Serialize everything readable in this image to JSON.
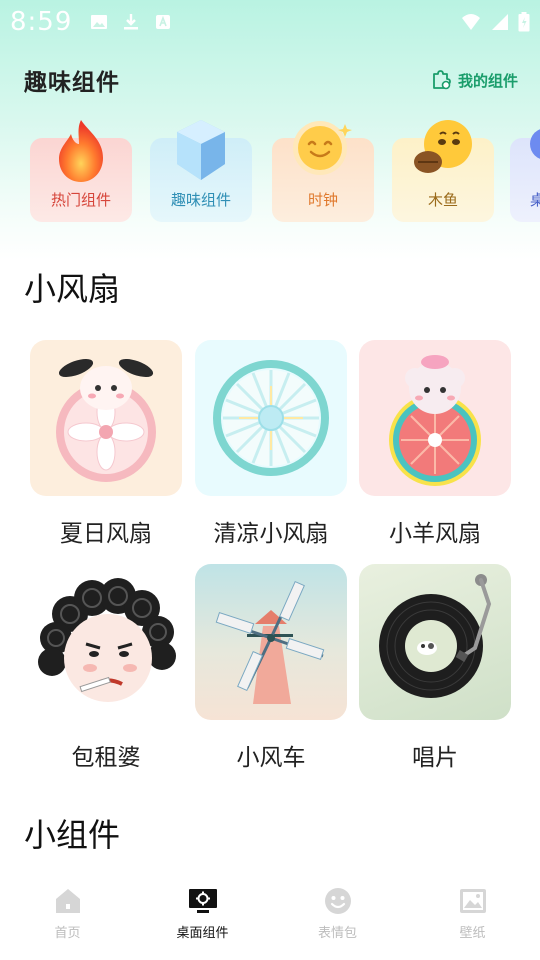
{
  "status_bar": {
    "time": "8:59"
  },
  "header": {
    "title": "趣味组件",
    "my_widgets_label": "我的组件"
  },
  "categories": [
    {
      "label": "热门组件",
      "icon": "flame-icon"
    },
    {
      "label": "趣味组件",
      "icon": "crystal-cube-icon"
    },
    {
      "label": "时钟",
      "icon": "smiley-clock-icon"
    },
    {
      "label": "木鱼",
      "icon": "wooden-fish-emoji-icon"
    },
    {
      "label": "桌",
      "icon": "partial-icon"
    }
  ],
  "sections": [
    {
      "title": "小风扇",
      "items": [
        {
          "label": "夏日风扇"
        },
        {
          "label": "清凉小风扇"
        },
        {
          "label": "小羊风扇"
        },
        {
          "label": "包租婆"
        },
        {
          "label": "小风车"
        },
        {
          "label": "唱片"
        }
      ]
    },
    {
      "title": "小组件"
    }
  ],
  "bottom_nav": [
    {
      "label": "首页",
      "icon": "home-icon",
      "active": false
    },
    {
      "label": "桌面组件",
      "icon": "desktop-widget-icon",
      "active": true
    },
    {
      "label": "表情包",
      "icon": "smiley-icon",
      "active": false
    },
    {
      "label": "壁纸",
      "icon": "wallpaper-icon",
      "active": false
    }
  ]
}
